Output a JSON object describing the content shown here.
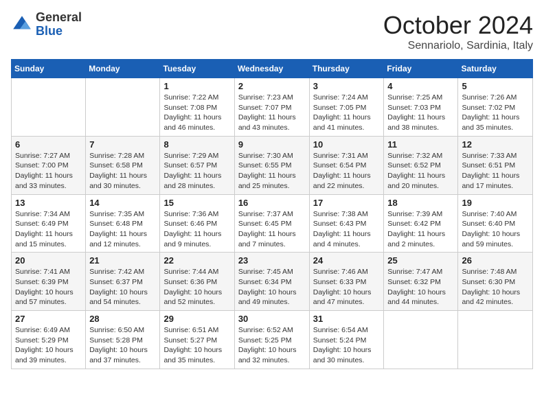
{
  "logo": {
    "general": "General",
    "blue": "Blue"
  },
  "header": {
    "month": "October 2024",
    "subtitle": "Sennariolo, Sardinia, Italy"
  },
  "weekdays": [
    "Sunday",
    "Monday",
    "Tuesday",
    "Wednesday",
    "Thursday",
    "Friday",
    "Saturday"
  ],
  "weeks": [
    [
      {
        "day": "",
        "info": ""
      },
      {
        "day": "",
        "info": ""
      },
      {
        "day": "1",
        "info": "Sunrise: 7:22 AM\nSunset: 7:08 PM\nDaylight: 11 hours and 46 minutes."
      },
      {
        "day": "2",
        "info": "Sunrise: 7:23 AM\nSunset: 7:07 PM\nDaylight: 11 hours and 43 minutes."
      },
      {
        "day": "3",
        "info": "Sunrise: 7:24 AM\nSunset: 7:05 PM\nDaylight: 11 hours and 41 minutes."
      },
      {
        "day": "4",
        "info": "Sunrise: 7:25 AM\nSunset: 7:03 PM\nDaylight: 11 hours and 38 minutes."
      },
      {
        "day": "5",
        "info": "Sunrise: 7:26 AM\nSunset: 7:02 PM\nDaylight: 11 hours and 35 minutes."
      }
    ],
    [
      {
        "day": "6",
        "info": "Sunrise: 7:27 AM\nSunset: 7:00 PM\nDaylight: 11 hours and 33 minutes."
      },
      {
        "day": "7",
        "info": "Sunrise: 7:28 AM\nSunset: 6:58 PM\nDaylight: 11 hours and 30 minutes."
      },
      {
        "day": "8",
        "info": "Sunrise: 7:29 AM\nSunset: 6:57 PM\nDaylight: 11 hours and 28 minutes."
      },
      {
        "day": "9",
        "info": "Sunrise: 7:30 AM\nSunset: 6:55 PM\nDaylight: 11 hours and 25 minutes."
      },
      {
        "day": "10",
        "info": "Sunrise: 7:31 AM\nSunset: 6:54 PM\nDaylight: 11 hours and 22 minutes."
      },
      {
        "day": "11",
        "info": "Sunrise: 7:32 AM\nSunset: 6:52 PM\nDaylight: 11 hours and 20 minutes."
      },
      {
        "day": "12",
        "info": "Sunrise: 7:33 AM\nSunset: 6:51 PM\nDaylight: 11 hours and 17 minutes."
      }
    ],
    [
      {
        "day": "13",
        "info": "Sunrise: 7:34 AM\nSunset: 6:49 PM\nDaylight: 11 hours and 15 minutes."
      },
      {
        "day": "14",
        "info": "Sunrise: 7:35 AM\nSunset: 6:48 PM\nDaylight: 11 hours and 12 minutes."
      },
      {
        "day": "15",
        "info": "Sunrise: 7:36 AM\nSunset: 6:46 PM\nDaylight: 11 hours and 9 minutes."
      },
      {
        "day": "16",
        "info": "Sunrise: 7:37 AM\nSunset: 6:45 PM\nDaylight: 11 hours and 7 minutes."
      },
      {
        "day": "17",
        "info": "Sunrise: 7:38 AM\nSunset: 6:43 PM\nDaylight: 11 hours and 4 minutes."
      },
      {
        "day": "18",
        "info": "Sunrise: 7:39 AM\nSunset: 6:42 PM\nDaylight: 11 hours and 2 minutes."
      },
      {
        "day": "19",
        "info": "Sunrise: 7:40 AM\nSunset: 6:40 PM\nDaylight: 10 hours and 59 minutes."
      }
    ],
    [
      {
        "day": "20",
        "info": "Sunrise: 7:41 AM\nSunset: 6:39 PM\nDaylight: 10 hours and 57 minutes."
      },
      {
        "day": "21",
        "info": "Sunrise: 7:42 AM\nSunset: 6:37 PM\nDaylight: 10 hours and 54 minutes."
      },
      {
        "day": "22",
        "info": "Sunrise: 7:44 AM\nSunset: 6:36 PM\nDaylight: 10 hours and 52 minutes."
      },
      {
        "day": "23",
        "info": "Sunrise: 7:45 AM\nSunset: 6:34 PM\nDaylight: 10 hours and 49 minutes."
      },
      {
        "day": "24",
        "info": "Sunrise: 7:46 AM\nSunset: 6:33 PM\nDaylight: 10 hours and 47 minutes."
      },
      {
        "day": "25",
        "info": "Sunrise: 7:47 AM\nSunset: 6:32 PM\nDaylight: 10 hours and 44 minutes."
      },
      {
        "day": "26",
        "info": "Sunrise: 7:48 AM\nSunset: 6:30 PM\nDaylight: 10 hours and 42 minutes."
      }
    ],
    [
      {
        "day": "27",
        "info": "Sunrise: 6:49 AM\nSunset: 5:29 PM\nDaylight: 10 hours and 39 minutes."
      },
      {
        "day": "28",
        "info": "Sunrise: 6:50 AM\nSunset: 5:28 PM\nDaylight: 10 hours and 37 minutes."
      },
      {
        "day": "29",
        "info": "Sunrise: 6:51 AM\nSunset: 5:27 PM\nDaylight: 10 hours and 35 minutes."
      },
      {
        "day": "30",
        "info": "Sunrise: 6:52 AM\nSunset: 5:25 PM\nDaylight: 10 hours and 32 minutes."
      },
      {
        "day": "31",
        "info": "Sunrise: 6:54 AM\nSunset: 5:24 PM\nDaylight: 10 hours and 30 minutes."
      },
      {
        "day": "",
        "info": ""
      },
      {
        "day": "",
        "info": ""
      }
    ]
  ]
}
